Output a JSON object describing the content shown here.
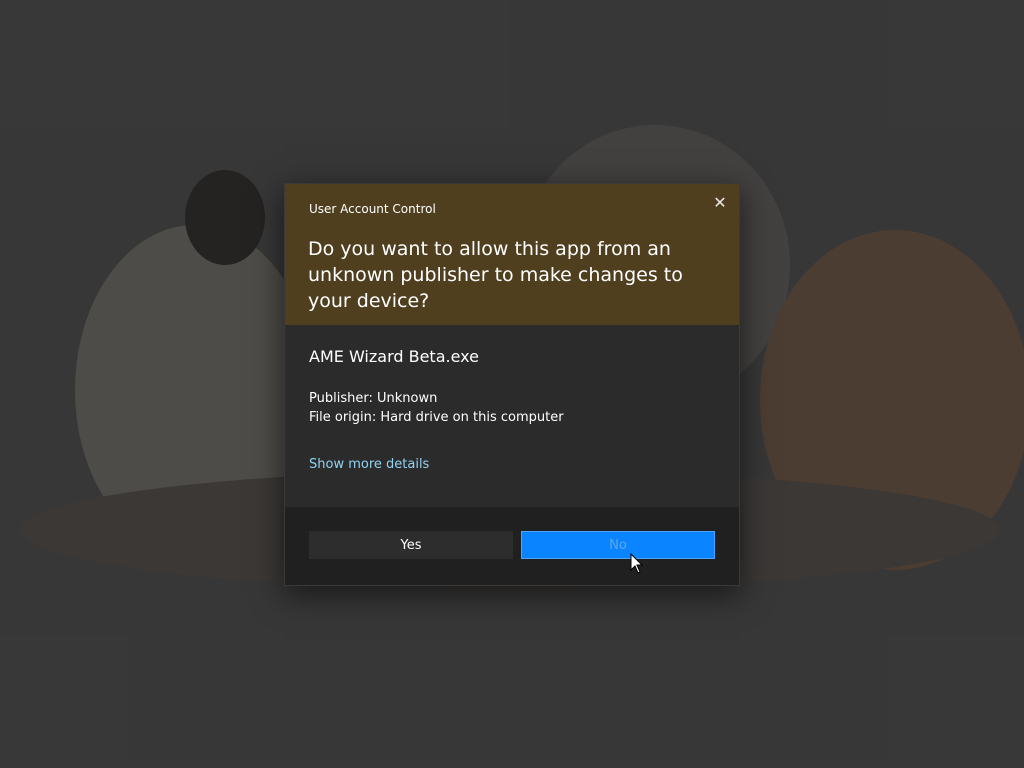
{
  "dialog": {
    "title": "User Account Control",
    "question": "Do you want to allow this app from an unknown publisher to make changes to your device?",
    "app_name": "AME Wizard Beta.exe",
    "publisher": "Publisher: Unknown",
    "file_origin": "File origin: Hard drive on this computer",
    "details_link": "Show more details",
    "close_icon": "close-icon",
    "buttons": {
      "yes": "Yes",
      "no": "No"
    },
    "colors": {
      "header": "#4f3f1f",
      "body": "#2b2b2b",
      "footer": "#202020",
      "link": "#8fd3f5",
      "primary_button": "#0a84ff"
    }
  },
  "background": {
    "description_icon": "wallpaper-kittens"
  },
  "pointer": {
    "icon": "mouse-pointer-icon"
  }
}
